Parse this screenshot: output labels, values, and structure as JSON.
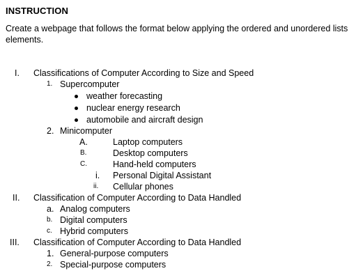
{
  "heading": "INSTRUCTION",
  "instruction": "Create a webpage that follows the format below applying the ordered and unordered lists elements.",
  "sections": [
    {
      "marker": "I.",
      "text": "Classifications of Computer According to Size and Speed",
      "items": [
        {
          "marker": "1.",
          "text": "Supercomputer",
          "bullets": [
            "weather forecasting",
            "nuclear energy research",
            "automobile and aircraft design"
          ]
        },
        {
          "marker": "2.",
          "text": "Minicomputer",
          "subitems": [
            {
              "marker": "A.",
              "text": "Laptop computers"
            },
            {
              "marker": "B.",
              "text": "Desktop computers"
            },
            {
              "marker": "C.",
              "text": "Hand-held computers"
            },
            {
              "marker": "i.",
              "text": "Personal Digital Assistant"
            },
            {
              "marker": "ii.",
              "text": "Cellular phones"
            }
          ]
        }
      ]
    },
    {
      "marker": "II.",
      "text": "Classification of Computer According to Data Handled",
      "items": [
        {
          "marker": "a.",
          "text": "Analog computers"
        },
        {
          "marker": "b.",
          "text": "Digital computers"
        },
        {
          "marker": "c.",
          "text": "Hybrid computers"
        }
      ]
    },
    {
      "marker": "III.",
      "text": "Classification of Computer According to Data Handled",
      "items": [
        {
          "marker": "1.",
          "text": "General-purpose computers"
        },
        {
          "marker": "2.",
          "text": "Special-purpose computers"
        }
      ]
    }
  ]
}
